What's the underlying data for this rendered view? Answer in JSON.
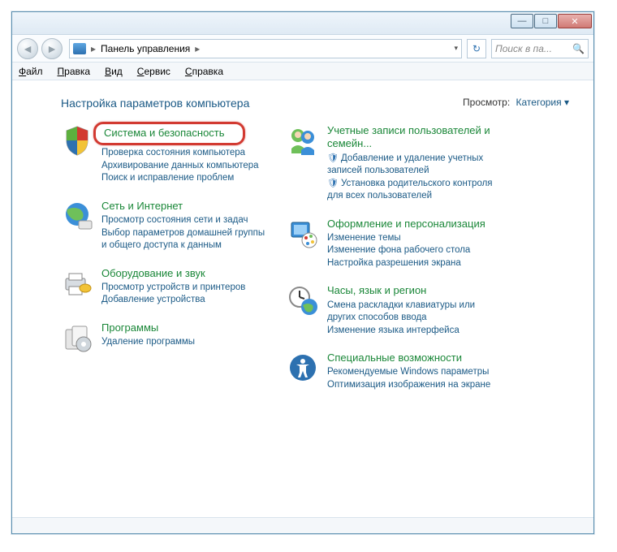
{
  "window": {
    "addressbar_title": "Панель управления",
    "search_placeholder": "Поиск в па..."
  },
  "menu": {
    "file": "Файл",
    "edit": "Правка",
    "view": "Вид",
    "tools": "Сервис",
    "help": "Справка"
  },
  "heading": "Настройка параметров компьютера",
  "view_label": "Просмотр:",
  "view_value": "Категория",
  "left": [
    {
      "title": "Система и безопасность",
      "links": [
        "Проверка состояния компьютера",
        "Архивирование данных компьютера",
        "Поиск и исправление проблем"
      ]
    },
    {
      "title": "Сеть и Интернет",
      "links": [
        "Просмотр состояния сети и задач",
        "Выбор параметров домашней группы и общего доступа к данным"
      ]
    },
    {
      "title": "Оборудование и звук",
      "links": [
        "Просмотр устройств и принтеров",
        "Добавление устройства"
      ]
    },
    {
      "title": "Программы",
      "links": [
        "Удаление программы"
      ]
    }
  ],
  "right": [
    {
      "title": "Учетные записи пользователей и семейн...",
      "links": [
        "Добавление и удаление учетных записей пользователей",
        "Установка родительского контроля для всех пользователей"
      ],
      "shield": [
        true,
        true
      ]
    },
    {
      "title": "Оформление и персонализация",
      "links": [
        "Изменение темы",
        "Изменение фона рабочего стола",
        "Настройка разрешения экрана"
      ]
    },
    {
      "title": "Часы, язык и регион",
      "links": [
        "Смена раскладки клавиатуры или других способов ввода",
        "Изменение языка интерфейса"
      ]
    },
    {
      "title": "Специальные возможности",
      "links": [
        "Рекомендуемые Windows параметры",
        "Оптимизация изображения на экране"
      ]
    }
  ]
}
